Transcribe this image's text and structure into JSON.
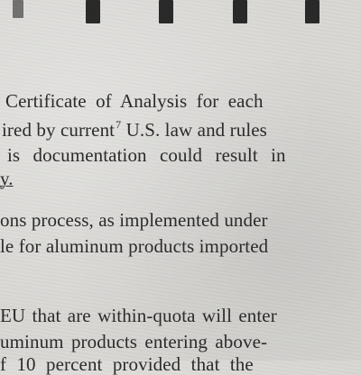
{
  "document": {
    "lines": [
      "Certificate of Analysis for each",
      "ired by current",
      " U.S. law and rules",
      "is documentation could result in",
      "y.",
      "ons process, as implemented under",
      "le for aluminum products imported",
      "EU that are within-quota will enter",
      "uminum products entering above-",
      "f 10 percent provided that the"
    ],
    "footnote_ref": "7"
  }
}
